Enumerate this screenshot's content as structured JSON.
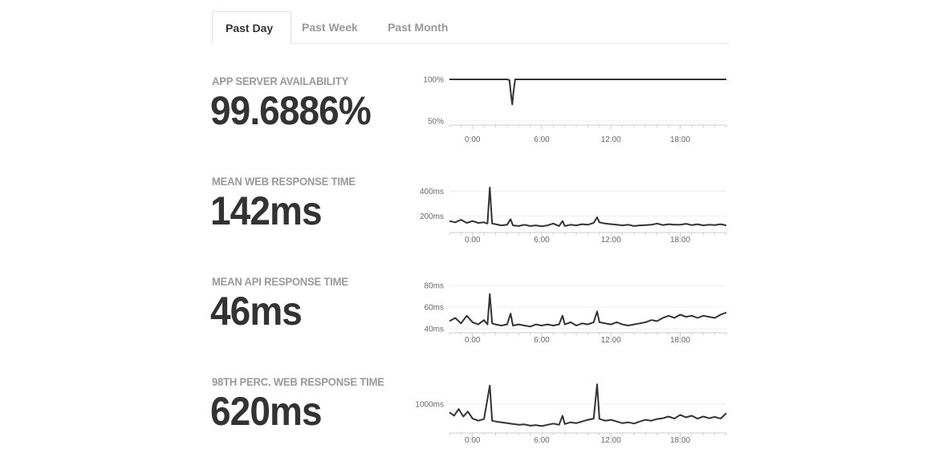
{
  "tabs": [
    {
      "label": "Past Day",
      "active": true
    },
    {
      "label": "Past Week",
      "active": false
    },
    {
      "label": "Past Month",
      "active": false
    }
  ],
  "metrics": [
    {
      "label": "APP SERVER AVAILABILITY",
      "value": "99.6886%"
    },
    {
      "label": "MEAN WEB RESPONSE TIME",
      "value": "142ms"
    },
    {
      "label": "MEAN API RESPONSE TIME",
      "value": "46ms"
    },
    {
      "label": "98TH PERC. WEB RESPONSE TIME",
      "value": "620ms"
    }
  ],
  "colors": {
    "line": "#333333",
    "grid": "#eeeeee",
    "axis_text": "#666666",
    "label": "#999999"
  },
  "chart_data": [
    {
      "type": "line",
      "x_ticks": [
        "0:00",
        "6:00",
        "12:00",
        "18:00"
      ],
      "y_ticks": [
        "100%",
        "50%"
      ],
      "y_tick_values": [
        100,
        50
      ],
      "ylim": [
        50,
        100
      ],
      "x_range_hours": [
        -2,
        22
      ],
      "series": [
        {
          "points": [
            [
              -2,
              100
            ],
            [
              3,
              100
            ],
            [
              3.2,
              99
            ],
            [
              3.35,
              80
            ],
            [
              3.45,
              70
            ],
            [
              3.55,
              85
            ],
            [
              3.7,
              100
            ],
            [
              22,
              100
            ]
          ]
        }
      ]
    },
    {
      "type": "line",
      "x_ticks": [
        "0:00",
        "6:00",
        "12:00",
        "18:00"
      ],
      "y_ticks": [
        "400ms",
        "200ms"
      ],
      "y_tick_values": [
        400,
        200
      ],
      "ylim": [
        100,
        500
      ],
      "x_range_hours": [
        -2,
        22
      ],
      "series": [
        {
          "points": [
            [
              -2,
              160
            ],
            [
              -1.5,
              150
            ],
            [
              -1,
              170
            ],
            [
              -0.5,
              145
            ],
            [
              0,
              160
            ],
            [
              0.5,
              145
            ],
            [
              1,
              150
            ],
            [
              1.3,
              140
            ],
            [
              1.5,
              430
            ],
            [
              1.7,
              140
            ],
            [
              2,
              135
            ],
            [
              2.5,
              125
            ],
            [
              3,
              130
            ],
            [
              3.3,
              175
            ],
            [
              3.5,
              125
            ],
            [
              4,
              120
            ],
            [
              4.5,
              130
            ],
            [
              5,
              120
            ],
            [
              5.5,
              125
            ],
            [
              6,
              118
            ],
            [
              6.5,
              125
            ],
            [
              7,
              140
            ],
            [
              7.5,
              120
            ],
            [
              7.8,
              160
            ],
            [
              8,
              120
            ],
            [
              8.5,
              130
            ],
            [
              9,
              125
            ],
            [
              9.5,
              135
            ],
            [
              10,
              130
            ],
            [
              10.5,
              145
            ],
            [
              10.8,
              190
            ],
            [
              11,
              150
            ],
            [
              11.5,
              140
            ],
            [
              12,
              135
            ],
            [
              12.5,
              130
            ],
            [
              13,
              125
            ],
            [
              13.5,
              130
            ],
            [
              14,
              120
            ],
            [
              14.5,
              125
            ],
            [
              15,
              128
            ],
            [
              15.5,
              130
            ],
            [
              16,
              140
            ],
            [
              16.5,
              128
            ],
            [
              17,
              135
            ],
            [
              17.5,
              130
            ],
            [
              18,
              130
            ],
            [
              18.5,
              138
            ],
            [
              19,
              128
            ],
            [
              19.5,
              135
            ],
            [
              20,
              125
            ],
            [
              20.5,
              130
            ],
            [
              21,
              128
            ],
            [
              21.5,
              135
            ],
            [
              22,
              125
            ]
          ]
        }
      ]
    },
    {
      "type": "line",
      "x_ticks": [
        "0:00",
        "6:00",
        "12:00",
        "18:00"
      ],
      "y_ticks": [
        "80ms",
        "60ms",
        "40ms"
      ],
      "y_tick_values": [
        80,
        60,
        40
      ],
      "ylim": [
        40,
        80
      ],
      "x_range_hours": [
        -2,
        22
      ],
      "series": [
        {
          "points": [
            [
              -2,
              47
            ],
            [
              -1.5,
              50
            ],
            [
              -1,
              45
            ],
            [
              -0.5,
              52
            ],
            [
              0,
              46
            ],
            [
              0.5,
              44
            ],
            [
              1,
              48
            ],
            [
              1.3,
              44
            ],
            [
              1.5,
              72
            ],
            [
              1.7,
              45
            ],
            [
              2,
              44
            ],
            [
              2.5,
              43
            ],
            [
              3,
              44
            ],
            [
              3.3,
              54
            ],
            [
              3.5,
              43
            ],
            [
              4,
              44
            ],
            [
              4.5,
              43
            ],
            [
              5,
              42
            ],
            [
              5.5,
              44
            ],
            [
              6,
              43
            ],
            [
              6.5,
              44
            ],
            [
              7,
              43
            ],
            [
              7.5,
              44
            ],
            [
              7.8,
              52
            ],
            [
              8,
              44
            ],
            [
              8.5,
              46
            ],
            [
              9,
              43
            ],
            [
              9.5,
              45
            ],
            [
              10,
              44
            ],
            [
              10.5,
              46
            ],
            [
              10.8,
              56
            ],
            [
              11,
              46
            ],
            [
              11.5,
              45
            ],
            [
              12,
              44
            ],
            [
              12.5,
              46
            ],
            [
              13,
              44
            ],
            [
              13.5,
              43
            ],
            [
              14,
              44
            ],
            [
              14.5,
              45
            ],
            [
              15,
              46
            ],
            [
              15.5,
              48
            ],
            [
              16,
              47
            ],
            [
              16.5,
              50
            ],
            [
              17,
              52
            ],
            [
              17.5,
              50
            ],
            [
              18,
              53
            ],
            [
              18.5,
              51
            ],
            [
              19,
              52
            ],
            [
              19.5,
              50
            ],
            [
              20,
              52
            ],
            [
              20.5,
              51
            ],
            [
              21,
              50
            ],
            [
              21.5,
              53
            ],
            [
              22,
              55
            ]
          ]
        }
      ]
    },
    {
      "type": "line",
      "x_ticks": [
        "0:00",
        "6:00",
        "12:00",
        "18:00"
      ],
      "y_ticks": [
        "1000ms"
      ],
      "y_tick_values": [
        1000
      ],
      "ylim": [
        400,
        1600
      ],
      "x_range_hours": [
        -2,
        22
      ],
      "series": [
        {
          "points": [
            [
              -2,
              800
            ],
            [
              -1.6,
              720
            ],
            [
              -1.2,
              880
            ],
            [
              -0.8,
              700
            ],
            [
              -0.4,
              820
            ],
            [
              0,
              650
            ],
            [
              0.5,
              600
            ],
            [
              1,
              640
            ],
            [
              1.5,
              1450
            ],
            [
              1.7,
              600
            ],
            [
              2,
              580
            ],
            [
              2.5,
              560
            ],
            [
              3,
              540
            ],
            [
              3.5,
              520
            ],
            [
              4,
              500
            ],
            [
              4.5,
              510
            ],
            [
              5,
              480
            ],
            [
              5.5,
              490
            ],
            [
              6,
              470
            ],
            [
              6.5,
              500
            ],
            [
              7,
              530
            ],
            [
              7.5,
              500
            ],
            [
              7.8,
              720
            ],
            [
              8,
              520
            ],
            [
              8.5,
              560
            ],
            [
              9,
              540
            ],
            [
              9.5,
              580
            ],
            [
              10,
              620
            ],
            [
              10.5,
              650
            ],
            [
              10.8,
              1480
            ],
            [
              11,
              640
            ],
            [
              11.5,
              600
            ],
            [
              12,
              620
            ],
            [
              12.5,
              580
            ],
            [
              13,
              540
            ],
            [
              13.5,
              560
            ],
            [
              14,
              530
            ],
            [
              14.5,
              580
            ],
            [
              15,
              620
            ],
            [
              15.5,
              600
            ],
            [
              16,
              640
            ],
            [
              16.5,
              660
            ],
            [
              17,
              700
            ],
            [
              17.5,
              650
            ],
            [
              18,
              740
            ],
            [
              18.5,
              680
            ],
            [
              19,
              720
            ],
            [
              19.5,
              650
            ],
            [
              20,
              700
            ],
            [
              20.5,
              660
            ],
            [
              21,
              690
            ],
            [
              21.5,
              650
            ],
            [
              22,
              780
            ]
          ]
        }
      ]
    }
  ]
}
